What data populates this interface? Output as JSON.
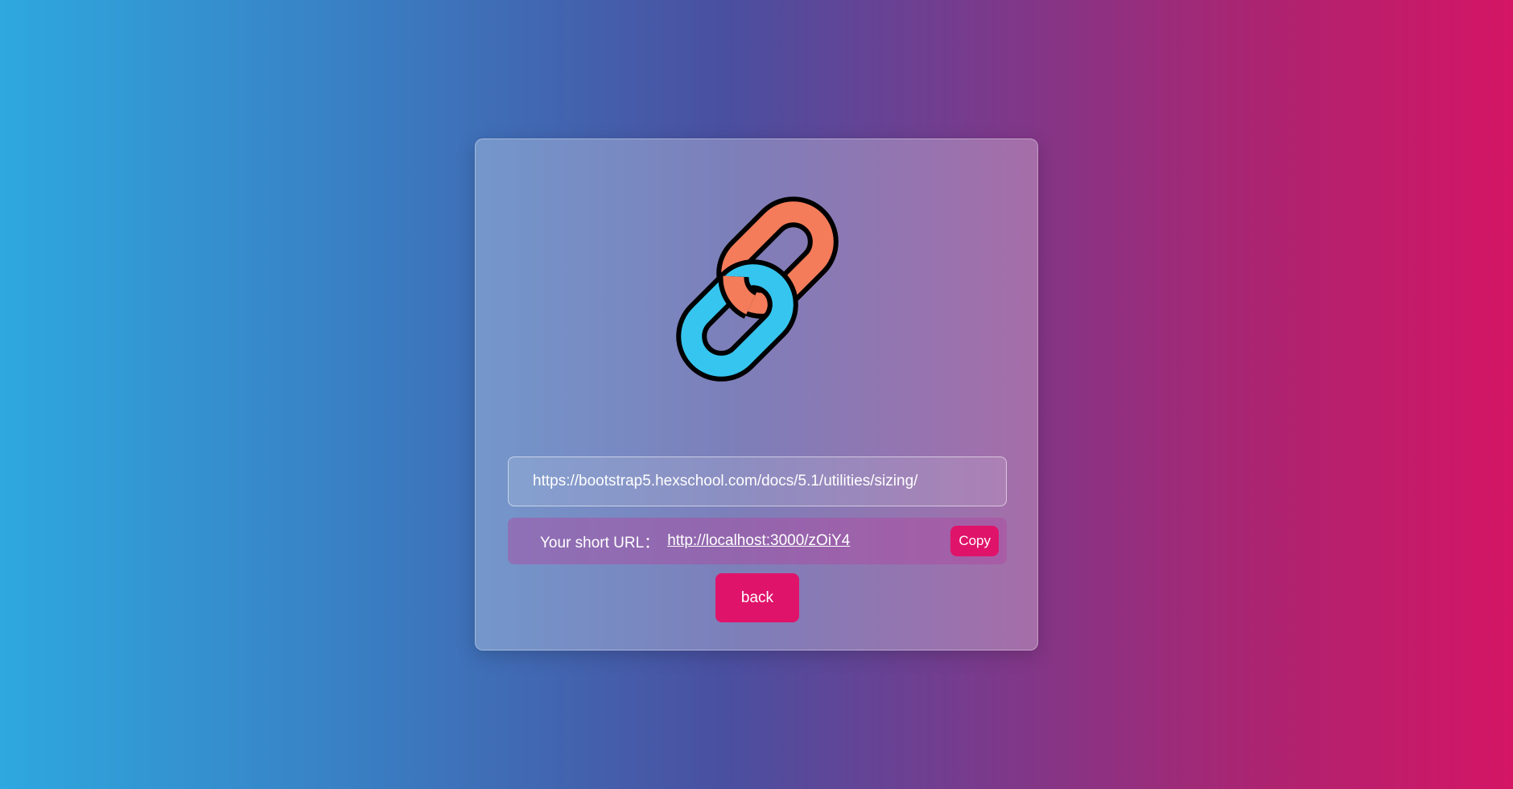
{
  "logo": {
    "icon": "chain-link-icon",
    "colors": {
      "link_a": "#f47c5a",
      "link_b": "#36c5ee",
      "outline": "#000000"
    }
  },
  "form": {
    "long_url_value": "https://bootstrap5.hexschool.com/docs/5.1/utilities/sizing/"
  },
  "result": {
    "label": "Your short URL：",
    "short_url": "http://localhost:3000/zOiY4",
    "copy_label": "Copy"
  },
  "actions": {
    "back_label": "back"
  },
  "colors": {
    "accent": "#e0136a"
  }
}
